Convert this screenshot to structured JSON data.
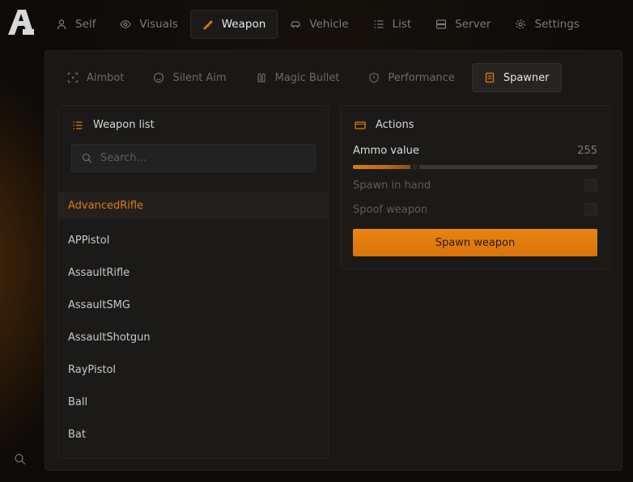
{
  "logo": {
    "letter": "A"
  },
  "top_nav": {
    "tabs": [
      {
        "label": "Self",
        "icon": "user-icon"
      },
      {
        "label": "Visuals",
        "icon": "eye-icon"
      },
      {
        "label": "Weapon",
        "icon": "weapon-icon",
        "active": true
      },
      {
        "label": "Vehicle",
        "icon": "car-icon"
      },
      {
        "label": "List",
        "icon": "list-icon"
      },
      {
        "label": "Server",
        "icon": "server-icon"
      },
      {
        "label": "Settings",
        "icon": "gear-icon"
      }
    ]
  },
  "sub_nav": {
    "tabs": [
      {
        "label": "Aimbot",
        "icon": "crosshair-icon"
      },
      {
        "label": "Silent Aim",
        "icon": "smiley-icon"
      },
      {
        "label": "Magic Bullet",
        "icon": "bullets-icon"
      },
      {
        "label": "Performance",
        "icon": "shield-icon"
      },
      {
        "label": "Spawner",
        "icon": "document-icon",
        "active": true
      }
    ]
  },
  "weapon_list": {
    "title": "Weapon list",
    "search_placeholder": "Search...",
    "items": [
      "AdvancedRifle",
      "APPistol",
      "AssaultRifle",
      "AssaultSMG",
      "AssaultShotgun",
      "RayPistol",
      "Ball",
      "Bat"
    ],
    "selected": "AdvancedRifle"
  },
  "actions": {
    "title": "Actions",
    "ammo_label": "Ammo value",
    "ammo_value": "255",
    "ammo_fraction": 0.25,
    "spawn_in_hand_label": "Spawn in hand",
    "spawn_in_hand_checked": false,
    "spoof_weapon_label": "Spoof weapon",
    "spoof_weapon_checked": false,
    "spawn_button_label": "Spawn weapon"
  },
  "colors": {
    "accent": "#e07a10",
    "background": "#0d0a08",
    "panel": "#1a1816"
  }
}
